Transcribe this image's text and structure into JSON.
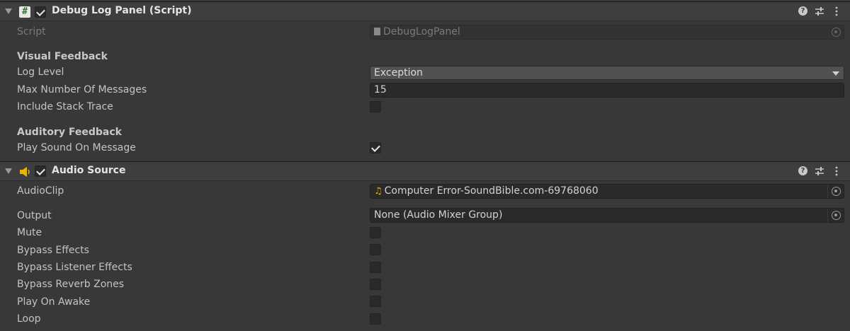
{
  "script_component": {
    "title": "Debug Log Panel (Script)",
    "enabled": true,
    "script_label": "Script",
    "script_value": "DebugLogPanel",
    "visual_feedback_header": "Visual Feedback",
    "log_level_label": "Log Level",
    "log_level_value": "Exception",
    "max_messages_label": "Max Number Of Messages",
    "max_messages_value": "15",
    "stack_trace_label": "Include Stack Trace",
    "stack_trace_checked": false,
    "auditory_feedback_header": "Auditory Feedback",
    "play_sound_label": "Play Sound On Message",
    "play_sound_checked": true
  },
  "audio_component": {
    "title": "Audio Source",
    "enabled": true,
    "audio_clip_label": "AudioClip",
    "audio_clip_value": "Computer Error-SoundBible.com-69768060",
    "output_label": "Output",
    "output_value": "None (Audio Mixer Group)",
    "toggles": [
      {
        "label": "Mute",
        "checked": false
      },
      {
        "label": "Bypass Effects",
        "checked": false
      },
      {
        "label": "Bypass Listener Effects",
        "checked": false
      },
      {
        "label": "Bypass Reverb Zones",
        "checked": false
      },
      {
        "label": "Play On Awake",
        "checked": false
      },
      {
        "label": "Loop",
        "checked": false
      }
    ]
  },
  "header_icons": [
    "help-icon",
    "preset-sliders-icon",
    "kebab-menu-icon"
  ],
  "colors": {
    "background": "#383838",
    "header": "#3e3e3e",
    "field": "#2a2a2a",
    "dropdown": "#515151",
    "audio_icon": "#e8b400",
    "script_icon": "#3fa84a"
  }
}
